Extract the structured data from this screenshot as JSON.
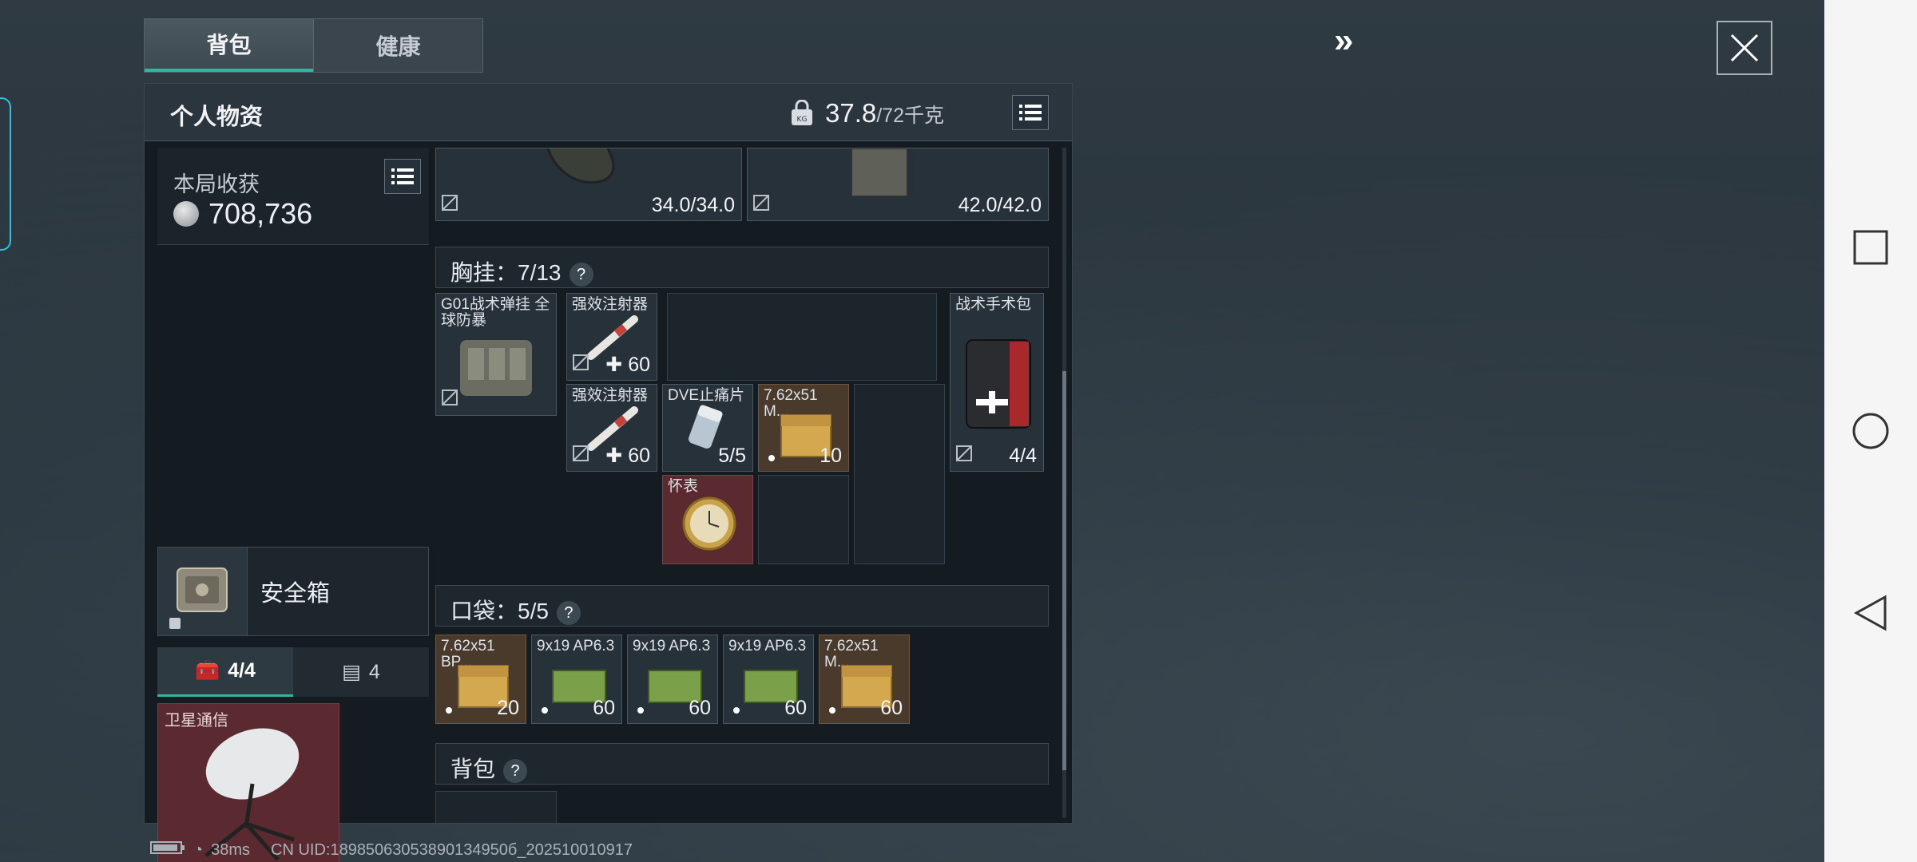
{
  "tabs": [
    "背包",
    "健康"
  ],
  "panel": {
    "title": "个人物资",
    "weight_current": "37.8",
    "weight_max": "/72千克"
  },
  "loot": {
    "label": "本局收获",
    "value": "708,736"
  },
  "equip_top": [
    {
      "durability": "34.0/34.0"
    },
    {
      "durability": "42.0/42.0"
    }
  ],
  "chest_rig": {
    "label": "胸挂：7/13",
    "items": [
      {
        "name": "G01战术弹挂 全球防暴"
      },
      {
        "name": "强效注射器",
        "count": "60"
      },
      {
        "name": "强效注射器",
        "count": "60"
      },
      {
        "name": "DVE止痛片",
        "count": "5/5"
      },
      {
        "name": "7.62x51 M...",
        "count": "10"
      },
      {
        "name": "怀表"
      },
      {
        "name": "战术手术包",
        "count": "4/4"
      }
    ]
  },
  "pockets": {
    "label": "口袋：5/5",
    "items": [
      {
        "name": "7.62x51 BP...",
        "count": "20"
      },
      {
        "name": "9x19 AP6.3",
        "count": "60"
      },
      {
        "name": "9x19 AP6.3",
        "count": "60"
      },
      {
        "name": "9x19 AP6.3",
        "count": "60"
      },
      {
        "name": "7.62x51 M...",
        "count": "60"
      }
    ]
  },
  "backpack_section": {
    "label": "背包"
  },
  "safebox": {
    "label": "安全箱"
  },
  "subtabs": {
    "case": "4/4",
    "container": "4"
  },
  "satellite": {
    "name": "卫星通信"
  },
  "status": {
    "ping": "38ms",
    "uid": "CN UID:18985063053890134950б_202510010917"
  },
  "colors": {
    "accent": "#2fb7a2",
    "red_rarity": "#5a2a30",
    "gold_rarity": "#4a3a2c"
  }
}
